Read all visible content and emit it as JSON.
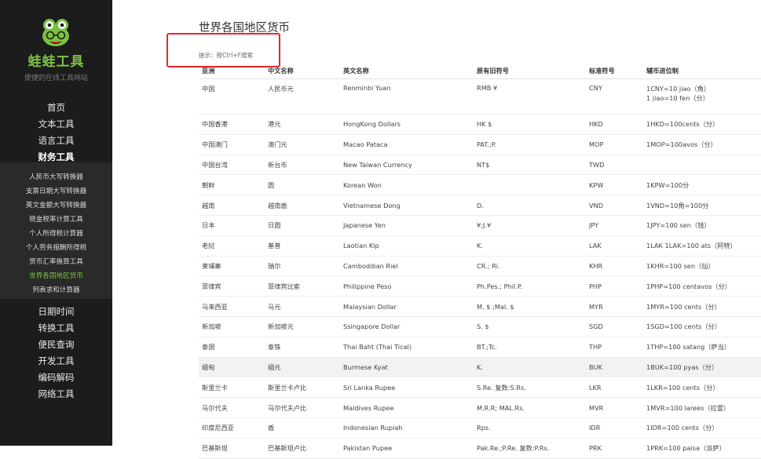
{
  "sidebar": {
    "brand": "蛙蛙工具",
    "tagline": "便捷的在线工具网站",
    "nav_top": [
      "首页",
      "文本工具",
      "语言工具",
      "财务工具"
    ],
    "sub_items": [
      "人民币大写转换器",
      "支票日期大写转换器",
      "英文金额大写转换器",
      "税金税率计算工具",
      "个人所得税计算器",
      "个人劳务报酬所得税",
      "货币汇率换算工具",
      "世界各国地区货币",
      "列表求和计算器"
    ],
    "nav_bottom": [
      "日期时间",
      "转换工具",
      "便民查询",
      "开发工具",
      "编码解码",
      "网络工具"
    ],
    "accent_color": "#7ac142"
  },
  "page": {
    "title": "世界各国地区货币",
    "hint": "提示：按Ctrl+F搜索"
  },
  "table": {
    "headers": [
      "亚洲",
      "中文名称",
      "英文名称",
      "原有旧符号",
      "标准符号",
      "辅币进位制"
    ],
    "rows": [
      [
        "中国",
        "人民币元",
        "Renminbi Yuan",
        "RMB ¥",
        "CNY",
        "1CNY=10 jiao（角）",
        "1 jiao=10 fen（分）"
      ],
      [
        "中国香港",
        "港元",
        "HongKong Dollars",
        "HK $",
        "HKD",
        "1HKD=100cents（分）"
      ],
      [
        "中国澳门",
        "澳门元",
        "Macao Pataca",
        "PAT.;P.",
        "MOP",
        "1MOP=100avos（分）"
      ],
      [
        "中国台湾",
        "新台币",
        "New Taiwan Currency",
        "NT$",
        "TWD",
        ""
      ],
      [
        "朝鲜",
        "圆",
        "Korean Won",
        "",
        "KPW",
        "1KPW=100分"
      ],
      [
        "越南",
        "越南盾",
        "Vietnamese Dong",
        "D.",
        "VND",
        "1VND=10角=100分"
      ],
      [
        "日本",
        "日圆",
        "Japanese Yen",
        "¥;J.¥",
        "JPY",
        "1JPY=100 sen（钱）"
      ],
      [
        "老挝",
        "基普",
        "Laotian Kip",
        "K.",
        "LAK",
        "1LAK 1LAK=100 ats（阿特）"
      ],
      [
        "柬埔寨",
        "瑞尔",
        "Camboddian Riel",
        "CR.; Ri.",
        "KHR",
        "1KHR=100 sen（仙）"
      ],
      [
        "菲律宾",
        "菲律宾比索",
        "Philippine Peso",
        "Ph.Pes.; Phil.P.",
        "PHP",
        "1PHP=100 centavos（分）"
      ],
      [
        "马来西亚",
        "马元",
        "Malaysian Dollar",
        "M. $ ;Mal. $",
        "MYR",
        "1MYR=100 cents（分）"
      ],
      [
        "新加坡",
        "新加坡元",
        "Ssingapore Dollar",
        "S. $",
        "SGD",
        "1SGD=100 cents（分）"
      ],
      [
        "泰国",
        "泰铢",
        "Thai Baht (Thai Tical)",
        "BT.;Tc.",
        "THP",
        "1THP=100 satang（萨当）"
      ],
      [
        "缅甸",
        "缅元",
        "Burmese Kyat",
        "K.",
        "BUK",
        "1BUK=100 pyas（分）"
      ],
      [
        "斯里兰卡",
        "斯里兰卡卢比",
        "Sri Lanka Rupee",
        "S.Re. 复数:S.Rs.",
        "LKR",
        "1LKR=100 cents（分）"
      ],
      [
        "马尔代夫",
        "马尔代夫卢比",
        "Maldives Rupee",
        "M.R.R; MAL.Rs.",
        "MVR",
        "1MVR=100 larees（拉雷）"
      ],
      [
        "印度尼西亚",
        "盾",
        "Indonesian Rupiah",
        "Rps.",
        "IDR",
        "1IDR=100 cents（分）"
      ],
      [
        "巴基斯坦",
        "巴基斯坦卢比",
        "Pakistan Pupee",
        "Pak.Re.;P.Re. 复数:P.Rs.",
        "PRK",
        "1PRK=100 paisa（派萨）"
      ]
    ]
  },
  "highlight_color": "#e8262b"
}
